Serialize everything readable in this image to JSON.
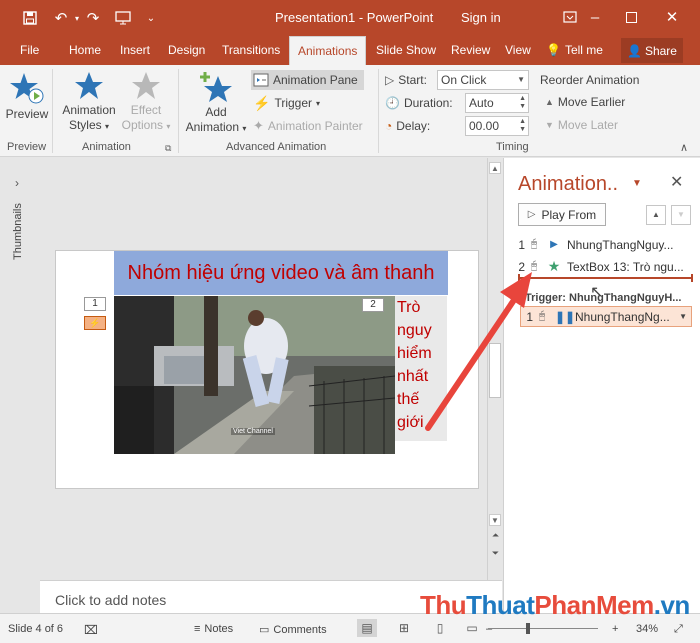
{
  "titlebar": {
    "title": "Presentation1 - PowerPoint",
    "signin": "Sign in"
  },
  "tabs": [
    "File",
    "Home",
    "Insert",
    "Design",
    "Transitions",
    "Animations",
    "Slide Show",
    "Review",
    "View"
  ],
  "tell_me": "Tell me",
  "share": "Share",
  "ribbon": {
    "preview": {
      "label": "Preview",
      "group": "Preview"
    },
    "animation_group": {
      "styles_label_1": "Animation",
      "styles_label_2": "Styles",
      "options_label_1": "Effect",
      "options_label_2": "Options",
      "group": "Animation"
    },
    "advanced": {
      "add_label_1": "Add",
      "add_label_2": "Animation",
      "pane": "Animation Pane",
      "trigger": "Trigger",
      "painter": "Animation Painter",
      "group": "Advanced Animation"
    },
    "timing": {
      "start_label": "Start:",
      "start_value": "On Click",
      "duration_label": "Duration:",
      "duration_value": "Auto",
      "delay_label": "Delay:",
      "delay_value": "00.00",
      "reorder": "Reorder Animation",
      "move_earlier": "Move Earlier",
      "move_later": "Move Later",
      "group": "Timing"
    }
  },
  "thumbnails_label": "Thumbnails",
  "slide": {
    "title": "Nhóm hiệu ứng video và âm thanh",
    "tag1": "1",
    "tag2": "2",
    "side_lines": [
      "Trò",
      "nguy",
      "hiểm",
      "nhất",
      "thế",
      "giới"
    ],
    "video_caption": "Viet Channel"
  },
  "notes_placeholder": "Click to add notes",
  "pane": {
    "title": "Animation..",
    "play_from": "Play From",
    "items": [
      {
        "num": "1",
        "name": "NhungThangNguy..."
      },
      {
        "num": "2",
        "name": "TextBox 13: Trò ngu..."
      }
    ],
    "trigger_label": "Trigger: NhungThangNguyH...",
    "trigger_item": {
      "num": "1",
      "name": "NhungThangNg..."
    }
  },
  "status": {
    "slide": "Slide 4 of 6",
    "notes": "Notes",
    "comments": "Comments",
    "zoom": "34%"
  },
  "watermark": {
    "part1": "Thu",
    "part2": "Thuat",
    "part3": "PhanMem",
    "part4": ".vn"
  },
  "colors": {
    "accent": "#b7472a",
    "title_bar": "#b7472a",
    "slide_title_bg": "#8ea9db",
    "slide_text": "#c00000",
    "arrow": "#e8453c"
  }
}
